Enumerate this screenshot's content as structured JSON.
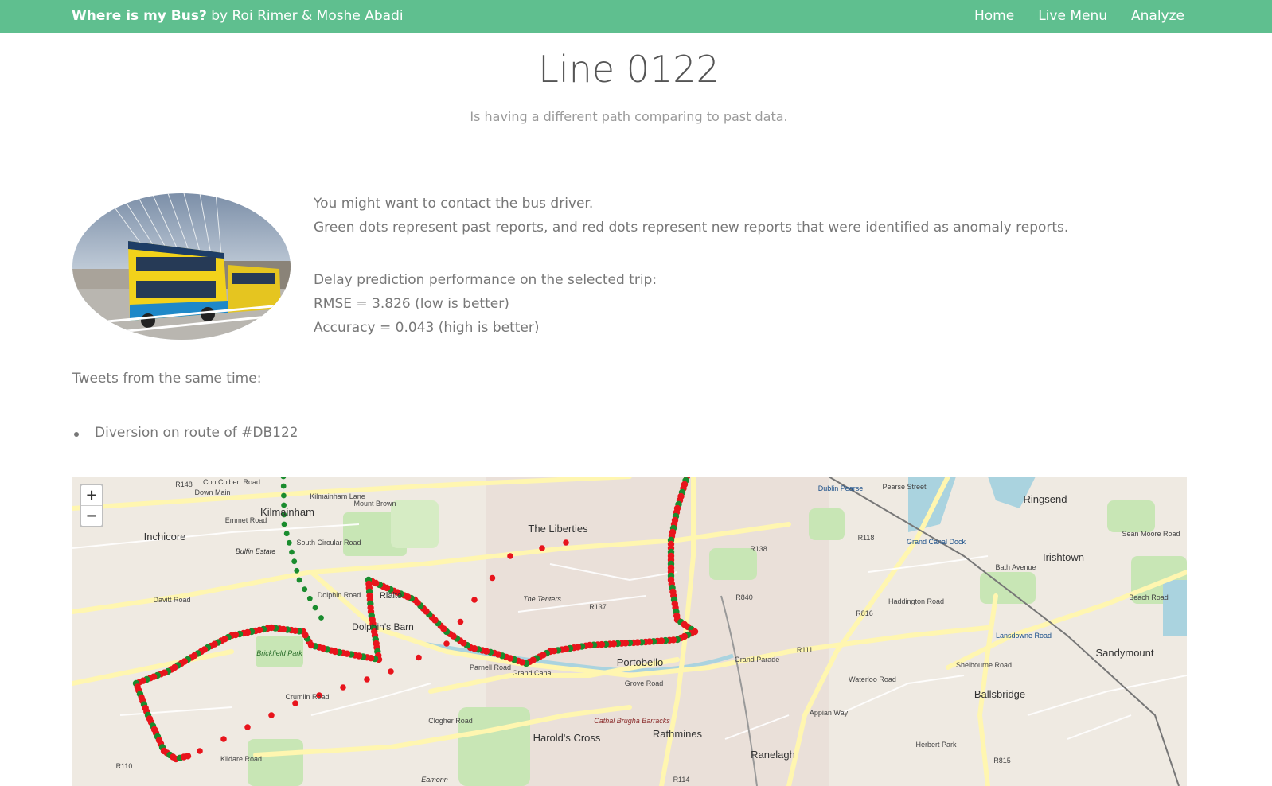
{
  "navbar": {
    "brand_bold": "Where is my Bus?",
    "brand_rest": " by Roi Rimer & Moshe Abadi",
    "links": [
      "Home",
      "Live Menu",
      "Analyze"
    ]
  },
  "page": {
    "title": "Line 0122",
    "subtitle": "Is having a different path comparing to past data."
  },
  "info": {
    "line1": "You might want to contact the bus driver.",
    "line2": "Green dots represent past reports, and red dots represent new reports that were identified as anomaly reports.",
    "line3": "Delay prediction performance on the selected trip:",
    "line4": "RMSE = 3.826 (low is better)",
    "line5": "Accuracy = 0.043 (high is better)"
  },
  "tweets": {
    "heading": "Tweets from the same time:",
    "items": [
      "Diversion on route of #DB122"
    ]
  },
  "map": {
    "zoom_in": "+",
    "zoom_out": "−",
    "legend_colors": {
      "past": "#1a8c2e",
      "anomaly": "#e8141c"
    },
    "place_labels": [
      "Kilmainham",
      "Inchicore",
      "The Liberties",
      "Portobello",
      "Rathmines",
      "Ranelagh",
      "Ballsbridge",
      "Ringsend",
      "Irishtown",
      "Sandymount",
      "Harold's Cross",
      "Dolphin's Barn",
      "Rialto",
      "Bulfin Estate",
      "Brickfield Park",
      "Grand Canal Dock",
      "Lansdowne Road",
      "Dublin Pearse",
      "Cathal Brugha Barracks",
      "Eamonn",
      "The Tenters"
    ],
    "road_labels": [
      "R148",
      "Con Colbert Road",
      "Emmet Road",
      "South Circular Road",
      "Davitt Road",
      "Dolphin Road",
      "Parnell Road",
      "Grand Canal",
      "Grove Road",
      "Clogher Road",
      "Kildare Road",
      "R110",
      "R137",
      "R138",
      "R840",
      "R111",
      "R816",
      "R118",
      "R815",
      "R114",
      "Mount Brown",
      "Kilmainham Lane",
      "Bath Avenue",
      "Haddington Road",
      "Pearse Street",
      "Grand Parade",
      "Beach Road",
      "Sean Moore Road",
      "Shelbourne Road",
      "Herbert Park",
      "Appian Way",
      "Waterloo Road",
      "Crumlin Road",
      "Down Main"
    ]
  }
}
